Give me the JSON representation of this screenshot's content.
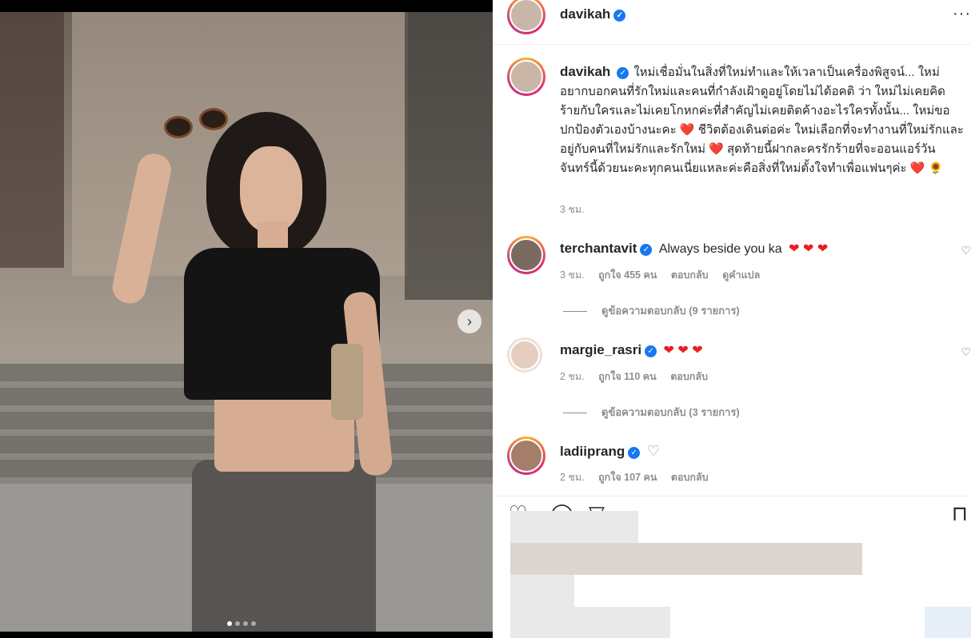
{
  "post": {
    "author": "davikah",
    "caption": "ใหม่เชื่อมั่นในสิ่งที่ใหม่ทำและให้เวลาเป็นเครื่องพิสูจน์... ใหม่อยากบอกคนที่รักใหม่และคนที่กำลังเฝ้าดูอยู่โดยไม่ได้อคติ ว่า ใหม่ไม่เคยคิดร้ายกับใครและไม่เคยโกหกค่ะที่สำคัญไม่เคยติดค้างอะไรใครทั้งนั้น... ใหม่ขอปกป้องตัวเองบ้างนะคะ ❤️ ชีวิตต้องเดินต่อค่ะ ใหม่เลือกที่จะทำงานที่ใหม่รักและอยู่กับคนที่ใหม่รักและรักใหม่ ❤️ สุดท้ายนี้ฝากละครรักร้ายที่จะออนแอร์วันจันทร์นี้ด้วยนะคะทุกคนเนี่ยแหละค่ะคือสิ่งที่ใหม่ตั้งใจทำเพื่อแฟนๆค่ะ ❤️ 🌻",
    "time": "3 ชม.",
    "more_icon": "ellipsis-icon"
  },
  "comments": [
    {
      "username": "terchantavit",
      "text": "Always beside you ka",
      "hearts": "❤ ❤ ❤",
      "time": "3 ชม.",
      "likes": "ถูกใจ 455 คน",
      "reply": "ตอบกลับ",
      "translate": "ดูคำแปล",
      "view_replies": "ดูข้อความตอบกลับ (9 รายการ)"
    },
    {
      "username": "margie_rasri",
      "text": "",
      "hearts": "❤ ❤ ❤",
      "time": "2 ชม.",
      "likes": "ถูกใจ 110 คน",
      "reply": "ตอบกลับ",
      "view_replies": "ดูข้อความตอบกลับ (3 รายการ)"
    },
    {
      "username": "ladiiprang",
      "text": "",
      "hearts": "♡",
      "time": "2 ชม.",
      "likes": "ถูกใจ 107 คน",
      "reply": "ตอบกลับ"
    }
  ],
  "carousel": {
    "total": 4,
    "active": 1,
    "next_icon": "chevron-right-icon"
  },
  "colors": {
    "heart": "#ed1c24",
    "verified": "#1877f2",
    "muted": "#8e8e8e"
  }
}
